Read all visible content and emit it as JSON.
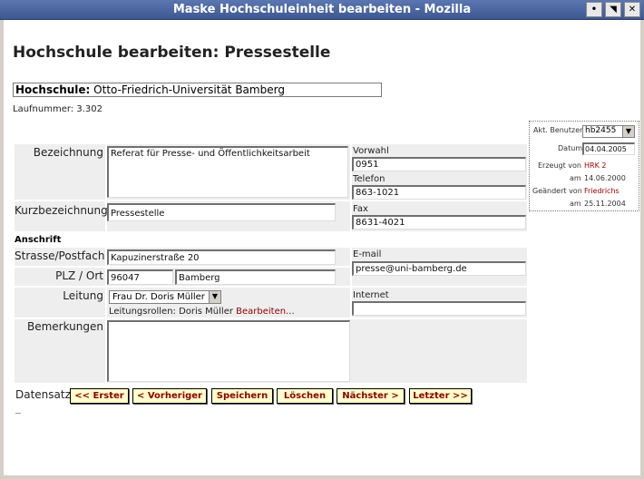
{
  "window": {
    "title": "Maske Hochschuleinheit bearbeiten - Mozilla",
    "buttons": [
      "•",
      "◥",
      "✕"
    ]
  },
  "page": {
    "heading": "Hochschule bearbeiten: Pressestelle",
    "hochschule_label": "Hochschule:",
    "hochschule_value": "Otto-Friedrich-Universität Bamberg",
    "laufnummer_label": "Laufnummer:",
    "laufnummer_value": "3.302"
  },
  "form": {
    "bezeichnung_label": "Bezeichnung",
    "bezeichnung_value": "Referat für Presse- und Öffentlichkeitsarbeit",
    "kurzbezeichnung_label": "Kurzbezeichnung",
    "kurzbezeichnung_value": "Pressestelle",
    "vorwahl_label": "Vorwahl",
    "vorwahl_value": "0951",
    "telefon_label": "Telefon",
    "telefon_value": "863-1021",
    "fax_label": "Fax",
    "fax_value": "8631-4021",
    "anschrift_heading": "Anschrift",
    "strasse_label": "Strasse/Postfach",
    "strasse_value": "Kapuzinerstraße 20",
    "plz_label": "PLZ / Ort",
    "plz_value": "96047",
    "ort_value": "Bamberg",
    "email_label": "E-mail",
    "email_value": "presse@uni-bamberg.de",
    "leitung_label": "Leitung",
    "leitung_value": "Frau Dr. Doris Müller",
    "internet_label": "Internet",
    "internet_value": "",
    "rollen_text": "Leitungsrollen: Doris Müller",
    "rollen_link": "Bearbeiten...",
    "bemerkungen_label": "Bemerkungen",
    "bemerkungen_value": ""
  },
  "info": {
    "benutzer_label": "Akt. Benutzer",
    "benutzer_value": "hb2455",
    "datum_label": "Datum",
    "datum_value": "04.04.2005",
    "erzeugt_label": "Erzeugt von",
    "erzeugt_value": "HRK 2",
    "erzeugt_am_label": "am",
    "erzeugt_am_value": "14.06.2000",
    "geaendert_label": "Geändert von",
    "geaendert_value": "Friedrichs",
    "geaendert_am_label": "am",
    "geaendert_am_value": "25.11.2004"
  },
  "nav": {
    "label": "Datensatz",
    "first": "<< Erster",
    "prev": "< Vorheriger",
    "save": "Speichern",
    "delete": "Löschen",
    "next": "Nächster >",
    "last": "Letzter >>"
  }
}
